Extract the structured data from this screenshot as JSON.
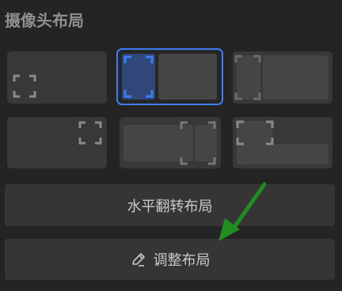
{
  "panel": {
    "title": "摄像头布局"
  },
  "buttons": {
    "flip_label": "水平翻转布局",
    "adjust_label": "调整布局",
    "adjust_icon": "edit-pen-icon"
  },
  "layouts": {
    "count": 6,
    "selected_index": 1
  },
  "colors": {
    "background": "#242424",
    "tile": "#383838",
    "accent": "#3d7df5",
    "arrow": "#1f8e1f"
  }
}
